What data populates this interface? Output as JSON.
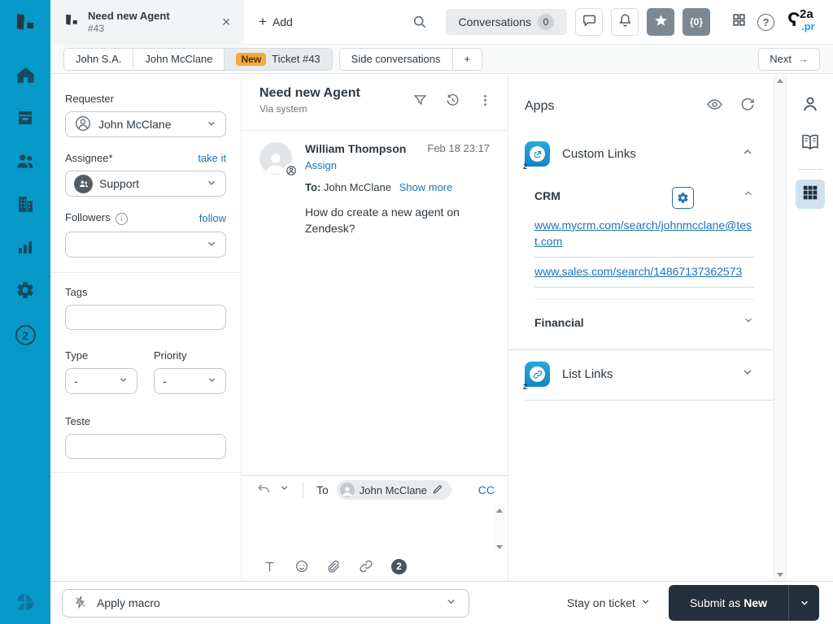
{
  "sidebar": {
    "items": [
      {
        "name": "home"
      },
      {
        "name": "views"
      },
      {
        "name": "customers"
      },
      {
        "name": "organizations"
      },
      {
        "name": "reporting"
      },
      {
        "name": "admin"
      },
      {
        "name": "app-shortcut"
      }
    ],
    "app_badge": "2"
  },
  "topbar": {
    "tab": {
      "title": "Need new Agent",
      "subtitle": "#43",
      "close": "✕"
    },
    "add_plus": "+",
    "add_label": "Add",
    "conversations": {
      "label": "Conversations",
      "count": "0"
    },
    "braces_label": "{0}",
    "help_label": "?",
    "avatar": {
      "hook": "Ɂ",
      "line1": "2a",
      "line2": ".pr"
    }
  },
  "subheader": {
    "tabs": [
      {
        "label": "John S.A."
      },
      {
        "label": "John McClane"
      },
      {
        "badge": "New",
        "label": "Ticket #43"
      }
    ],
    "side_tabs": [
      {
        "label": "Side conversations"
      },
      {
        "label": "+"
      }
    ],
    "next": {
      "label": "Next",
      "arrow": "→"
    }
  },
  "ticket_fields": {
    "requester": {
      "label": "Requester",
      "value": "John McClane"
    },
    "assignee": {
      "label": "Assignee*",
      "action": "take it",
      "value": "Support"
    },
    "followers": {
      "label": "Followers",
      "action": "follow",
      "info": "i"
    },
    "tags": {
      "label": "Tags",
      "value": ""
    },
    "type": {
      "label": "Type",
      "value": "-"
    },
    "priority": {
      "label": "Priority",
      "value": "-"
    },
    "teste": {
      "label": "Teste",
      "value": ""
    }
  },
  "conversation": {
    "title": "Need new Agent",
    "via": "Via system",
    "message": {
      "author": "William Thompson",
      "timestamp": "Feb 18 23:17",
      "assign": "Assign",
      "to_label": "To:",
      "to_value": "John McClane",
      "show_more": "Show more",
      "body": "How do create a new agent on Zendesk?"
    }
  },
  "composer": {
    "to_label": "To",
    "recipient": "John McClane",
    "cc": "CC",
    "app_badge": "2"
  },
  "apps_panel": {
    "title": "Apps",
    "custom_links": {
      "label": "Custom Links",
      "badge": "2",
      "crm": {
        "label": "CRM",
        "links": [
          "www.mycrm.com/search/johnmcclane@test.com",
          "www.sales.com/search/14867137362573"
        ]
      },
      "financial": {
        "label": "Financial"
      }
    },
    "list_links": {
      "label": "List Links",
      "badge": "2"
    }
  },
  "footer": {
    "macro_placeholder": "Apply macro",
    "stay": "Stay on ticket",
    "submit_prefix": "Submit as",
    "submit_status": "New"
  },
  "colors": {
    "brand_cyan": "#0799c7",
    "link_blue": "#1f73b7",
    "badge_orange": "#f5a83e",
    "submit_dark": "#232f3a",
    "app_icon_blue": "#189ad2"
  }
}
